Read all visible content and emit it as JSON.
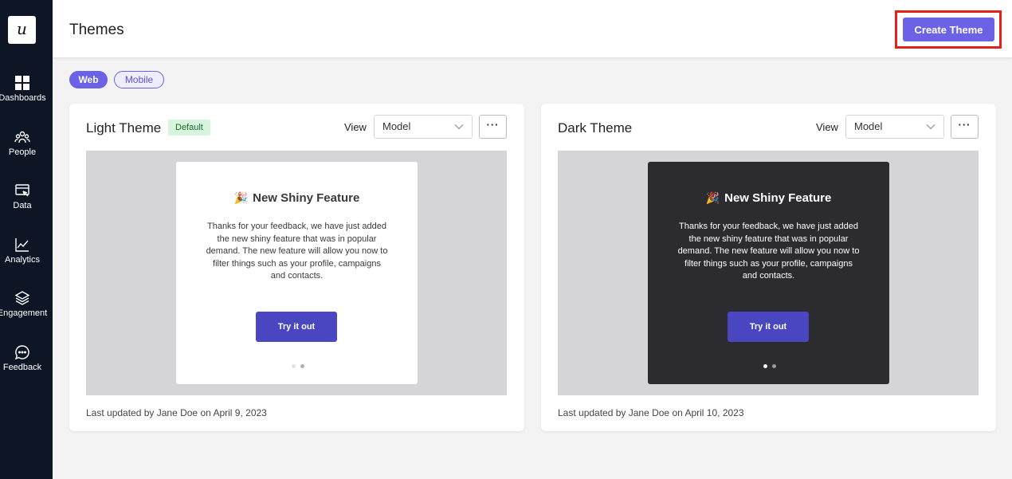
{
  "sidebar": {
    "logo": "u",
    "items": [
      {
        "label": "Dashboards",
        "icon": "dashboard-icon"
      },
      {
        "label": "People",
        "icon": "people-icon"
      },
      {
        "label": "Data",
        "icon": "data-icon"
      },
      {
        "label": "Analytics",
        "icon": "analytics-icon"
      },
      {
        "label": "Engagement",
        "icon": "layers-icon"
      },
      {
        "label": "Feedback",
        "icon": "chat-icon"
      }
    ]
  },
  "header": {
    "title": "Themes",
    "create_button": "Create Theme"
  },
  "tabs": {
    "web": "Web",
    "mobile": "Mobile",
    "active": "Web"
  },
  "themes": [
    {
      "name": "Light Theme",
      "badge": "Default",
      "view_label": "View",
      "view_value": "Model",
      "more": "···",
      "preview": {
        "emoji": "🎉",
        "title": "New Shiny Feature",
        "body": "Thanks for your feedback, we have just added the new shiny feature that was in popular demand. The new feature will allow you now to filter things such as your profile, campaigns and contacts.",
        "button": "Try it out"
      },
      "updated": "Last updated by Jane Doe on April 9, 2023"
    },
    {
      "name": "Dark Theme",
      "badge": "",
      "view_label": "View",
      "view_value": "Model",
      "more": "···",
      "preview": {
        "emoji": "🎉",
        "title": "New Shiny Feature",
        "body": "Thanks for your feedback, we have just added the new shiny feature that was in popular demand. The new feature will allow you now to filter things such as your profile, campaigns and contacts.",
        "button": "Try it out"
      },
      "updated": "Last updated by Jane Doe on April 10, 2023"
    }
  ],
  "colors": {
    "sidebar_bg": "#0e1525",
    "accent": "#6b62e6",
    "button_dark": "#4a45c0",
    "highlight_border": "#e0221b",
    "default_badge_bg": "#d6f5dc",
    "dark_modal_bg": "#2c2c30"
  }
}
